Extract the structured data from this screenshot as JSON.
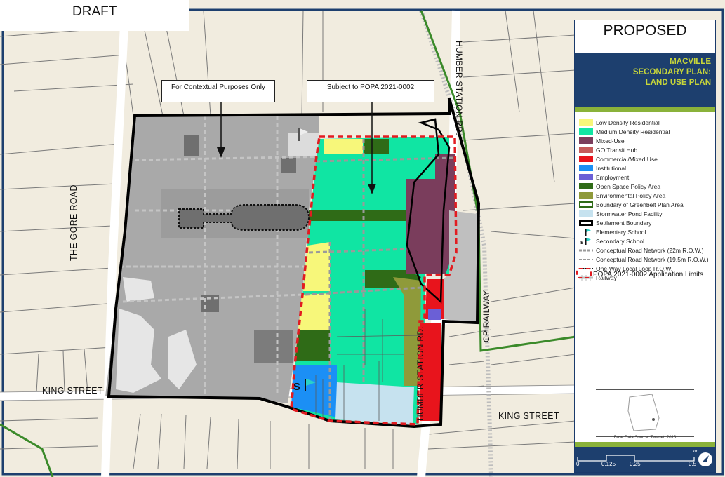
{
  "draft_label": "DRAFT",
  "callouts": {
    "contextual": "For Contextual Purposes Only",
    "subject": "Subject to POPA 2021-0002"
  },
  "road_labels": {
    "the_gore_road": "THE GORE ROAD",
    "king_street_west": "KING STREET",
    "king_street_east": "KING STREET",
    "humber_station_north": "HUMBER STATION RD.",
    "humber_station_south": "HUMBER STATION RD.",
    "cp_railway": "CP RAILWAY"
  },
  "school_marker": "S",
  "legend": {
    "status": "PROPOSED",
    "title_lines": [
      "MACVILLE",
      "SECONDARY PLAN:",
      "LAND USE PLAN"
    ],
    "items": [
      {
        "label": "Low Density Residential",
        "color": "#f7f77a",
        "kind": "fill"
      },
      {
        "label": "Medium Density Residential",
        "color": "#10e5a3",
        "kind": "fill"
      },
      {
        "label": "Mixed-Use",
        "color": "#7a3d5c",
        "kind": "fill"
      },
      {
        "label": "GO Transit Hub",
        "color": "#c55a5a",
        "kind": "fill"
      },
      {
        "label": "Commercial/Mixed Use",
        "color": "#e8141c",
        "kind": "fill"
      },
      {
        "label": "Institutional",
        "color": "#1b8ff5",
        "kind": "fill"
      },
      {
        "label": "Employment",
        "color": "#6b5fd6",
        "kind": "fill"
      },
      {
        "label": "Open Space Policy Area",
        "color": "#2f6b17",
        "kind": "fill"
      },
      {
        "label": "Environmental Policy Area",
        "color": "#8f9a3a",
        "kind": "fill"
      },
      {
        "label": "Boundary of Greenbelt Plan Area",
        "color": "#2f6b17",
        "kind": "outline"
      },
      {
        "label": "Stormwater Pond Facility",
        "color": "#c6e2ef",
        "kind": "fill"
      },
      {
        "label": "Settlement Boundary",
        "color": "#000000",
        "kind": "thick-outline"
      },
      {
        "label": "Elementary School",
        "color": "#2ad1c8",
        "kind": "icon"
      },
      {
        "label": "Secondary School",
        "color": "#2ad1c8",
        "kind": "icon"
      },
      {
        "label": "Conceptual Road Network (22m R.O.W.)",
        "color": "#9a9a9a",
        "kind": "dash-thick"
      },
      {
        "label": "Conceptual Road Network (19.5m R.O.W.)",
        "color": "#9a9a9a",
        "kind": "dash"
      },
      {
        "label": "One-Way Local Loop R.O.W.",
        "color": "#000000",
        "kind": "dash-dark"
      },
      {
        "label": "Railway",
        "color": "#bdbdbd",
        "kind": "rail"
      }
    ],
    "popa_limits": "POPA 2021-0002 Application Limits",
    "popa_color": "#e21c21",
    "base_data_source": "Base Data Source: Teranet, 2013",
    "scale": {
      "unit": "km",
      "ticks": [
        "0",
        "0.125",
        "0.25",
        "0.5"
      ]
    }
  },
  "colors": {
    "parcel_line": "#6e6e6e",
    "background": "#f1ecdf",
    "context_gray": "#a9a9a9",
    "road": "#ffffff",
    "frame": "#1d3f6e"
  }
}
